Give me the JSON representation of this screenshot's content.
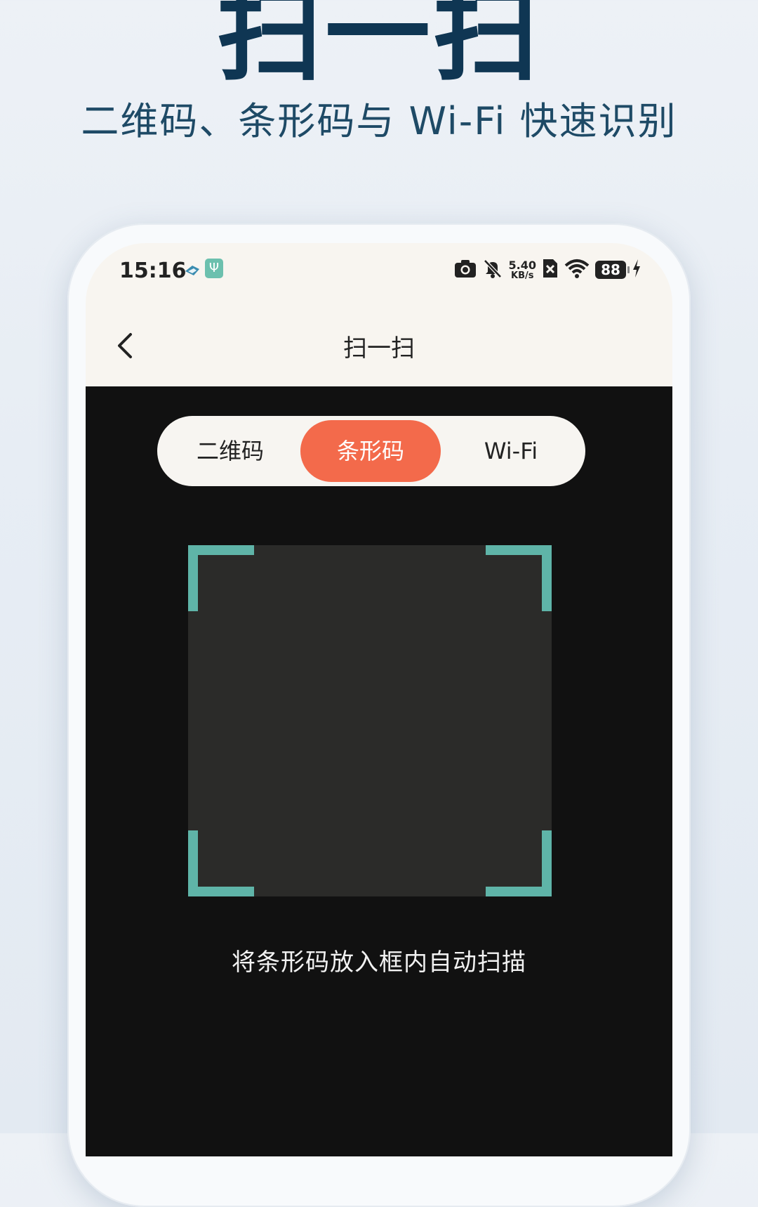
{
  "promo": {
    "title": "扫一扫",
    "subtitle": "二维码、条形码与 Wi-Fi 快速识别"
  },
  "status_bar": {
    "time": "15:16",
    "net_speed_value": "5.40",
    "net_speed_unit": "KB/s",
    "battery": "88",
    "icons": [
      "app-notification-icon",
      "usb-icon",
      "camera-icon",
      "mute-bell-icon",
      "no-sim-icon",
      "wifi-icon",
      "battery-icon",
      "charging-icon"
    ]
  },
  "header": {
    "title": "扫一扫",
    "back_icon": "chevron-left-icon"
  },
  "scan_modes": {
    "options": [
      "二维码",
      "条形码",
      "Wi-Fi"
    ],
    "selected": "条形码"
  },
  "viewfinder": {
    "hint": "将条形码放入框内自动扫描"
  },
  "colors": {
    "accent": "#f36a4b",
    "frame": "#5fb4a8",
    "promo_text": "#0f3653",
    "camera_bg": "#111111"
  }
}
